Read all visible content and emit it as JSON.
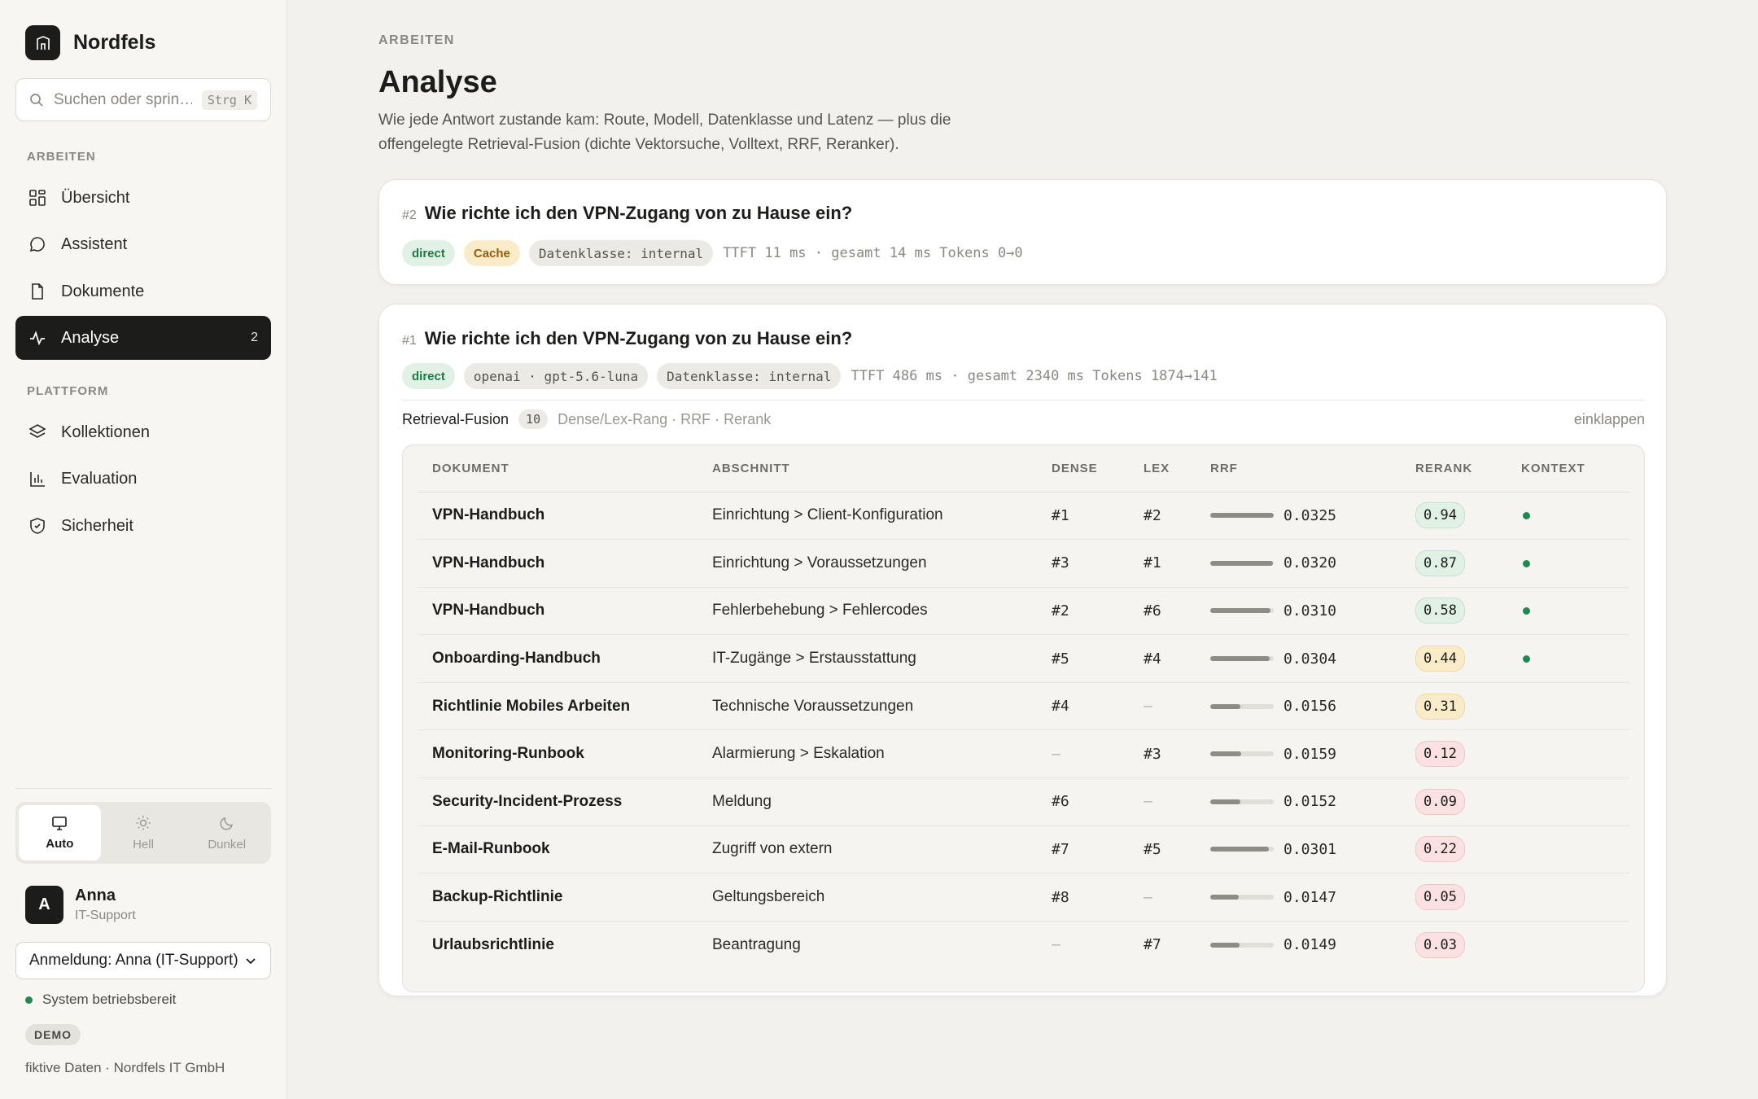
{
  "brand": {
    "name": "Nordfels"
  },
  "search": {
    "placeholder": "Suchen oder sprin…",
    "shortcut": "Strg K"
  },
  "sidebar": {
    "section_work": "ARBEITEN",
    "section_platform": "PLATTFORM",
    "items": [
      {
        "label": "Übersicht",
        "icon": "grid-icon"
      },
      {
        "label": "Assistent",
        "icon": "chat-bubble-icon"
      },
      {
        "label": "Dokumente",
        "icon": "document-icon"
      },
      {
        "label": "Analyse",
        "icon": "activity-icon",
        "badge": "2",
        "active": true
      },
      {
        "label": "Kollektionen",
        "icon": "layers-icon"
      },
      {
        "label": "Evaluation",
        "icon": "bar-chart-icon"
      },
      {
        "label": "Sicherheit",
        "icon": "shield-icon"
      }
    ],
    "theme": {
      "auto": "Auto",
      "light": "Hell",
      "dark": "Dunkel",
      "selected": "Auto"
    },
    "user": {
      "initial": "A",
      "name": "Anna",
      "role": "IT-Support"
    },
    "login_select": "Anmeldung: Anna (IT-Support)",
    "status": "System betriebsbereit",
    "demo_badge": "DEMO",
    "footer": "fiktive Daten · Nordfels IT GmbH"
  },
  "page": {
    "eyebrow": "ARBEITEN",
    "title": "Analyse",
    "description": "Wie jede Antwort zustande kam: Route, Modell, Datenklasse und Latenz — plus die offengelegte Retrieval-Fusion (dichte Vektorsuche, Volltext, RRF, Reranker)."
  },
  "queries": [
    {
      "num": "#2",
      "question": "Wie richte ich den VPN-Zugang von zu Hause ein?",
      "route": "direct",
      "source": "Cache",
      "data_class": "Datenklasse: internal",
      "meta": "TTFT 11 ms · gesamt 14 ms Tokens 0→0"
    },
    {
      "num": "#1",
      "question": "Wie richte ich den VPN-Zugang von zu Hause ein?",
      "route": "direct",
      "model": "openai · gpt-5.6-luna",
      "data_class": "Datenklasse: internal",
      "meta": "TTFT 486 ms · gesamt 2340 ms Tokens 1874→141"
    }
  ],
  "fusion": {
    "title": "Retrieval-Fusion",
    "count": "10",
    "subtitle": "Dense/Lex-Rang · RRF · Rerank",
    "collapse": "einklappen",
    "columns": [
      "DOKUMENT",
      "ABSCHNITT",
      "DENSE",
      "LEX",
      "RRF",
      "RERANK",
      "KONTEXT"
    ],
    "rows": [
      {
        "doc": "VPN-Handbuch",
        "section": "Einrichtung > Client-Konfiguration",
        "dense": "#1",
        "lex": "#2",
        "rrf": "0.0325",
        "rerank": "0.94",
        "level": "high",
        "context": true
      },
      {
        "doc": "VPN-Handbuch",
        "section": "Einrichtung > Voraussetzungen",
        "dense": "#3",
        "lex": "#1",
        "rrf": "0.0320",
        "rerank": "0.87",
        "level": "high",
        "context": true
      },
      {
        "doc": "VPN-Handbuch",
        "section": "Fehlerbehebung > Fehlercodes",
        "dense": "#2",
        "lex": "#6",
        "rrf": "0.0310",
        "rerank": "0.58",
        "level": "high",
        "context": true
      },
      {
        "doc": "Onboarding-Handbuch",
        "section": "IT-Zugänge > Erstausstattung",
        "dense": "#5",
        "lex": "#4",
        "rrf": "0.0304",
        "rerank": "0.44",
        "level": "mid",
        "context": true
      },
      {
        "doc": "Richtlinie Mobiles Arbeiten",
        "section": "Technische Voraussetzungen",
        "dense": "#4",
        "lex": "–",
        "rrf": "0.0156",
        "rerank": "0.31",
        "level": "mid",
        "context": false
      },
      {
        "doc": "Monitoring-Runbook",
        "section": "Alarmierung > Eskalation",
        "dense": "–",
        "lex": "#3",
        "rrf": "0.0159",
        "rerank": "0.12",
        "level": "low",
        "context": false
      },
      {
        "doc": "Security-Incident-Prozess",
        "section": "Meldung",
        "dense": "#6",
        "lex": "–",
        "rrf": "0.0152",
        "rerank": "0.09",
        "level": "low",
        "context": false
      },
      {
        "doc": "E-Mail-Runbook",
        "section": "Zugriff von extern",
        "dense": "#7",
        "lex": "#5",
        "rrf": "0.0301",
        "rerank": "0.22",
        "level": "low",
        "context": false
      },
      {
        "doc": "Backup-Richtlinie",
        "section": "Geltungsbereich",
        "dense": "#8",
        "lex": "–",
        "rrf": "0.0147",
        "rerank": "0.05",
        "level": "low",
        "context": false
      },
      {
        "doc": "Urlaubsrichtlinie",
        "section": "Beantragung",
        "dense": "–",
        "lex": "#7",
        "rrf": "0.0149",
        "rerank": "0.03",
        "level": "low",
        "context": false
      }
    ]
  }
}
